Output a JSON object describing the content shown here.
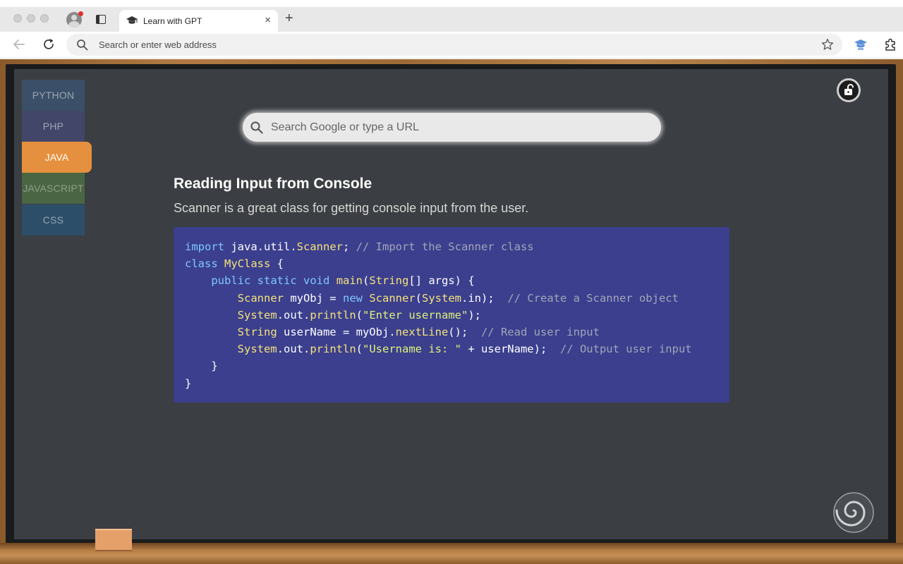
{
  "browser": {
    "tab_title": "Learn with GPT",
    "tab_close": "×",
    "new_tab": "+",
    "address_placeholder": "Search or enter web address"
  },
  "languages": [
    {
      "label": "PYTHON",
      "selected": false
    },
    {
      "label": "PHP",
      "selected": false
    },
    {
      "label": "JAVA",
      "selected": true
    },
    {
      "label": "JAVASCRIPT",
      "selected": false
    },
    {
      "label": "CSS",
      "selected": false
    }
  ],
  "search": {
    "placeholder": "Search Google or type a URL"
  },
  "lesson": {
    "title": "Reading Input from Console",
    "description": "Scanner is a great class for getting console input from the user.",
    "code_lines": [
      "import java.util.Scanner; // Import the Scanner class",
      "class MyClass {",
      "    public static void main(String[] args) {",
      "        Scanner myObj = new Scanner(System.in);  // Create a Scanner object",
      "        System.out.println(\"Enter username\");",
      "        String userName = myObj.nextLine();  // Read user input",
      "        System.out.println(\"Username is: \" + userName);  // Output user input",
      "    }",
      "}"
    ]
  },
  "colors": {
    "board": "#3b3e42",
    "java_tab": "#e5903e",
    "code_bg": "#3b3f8e"
  },
  "icons": [
    "profile-icon",
    "tabs-icon",
    "graduation-cap-icon",
    "back-arrow-icon",
    "reload-icon",
    "search-icon",
    "star-icon",
    "gpt-extension-icon",
    "extensions-puzzle-icon",
    "unlock-icon",
    "spiral-icon"
  ]
}
